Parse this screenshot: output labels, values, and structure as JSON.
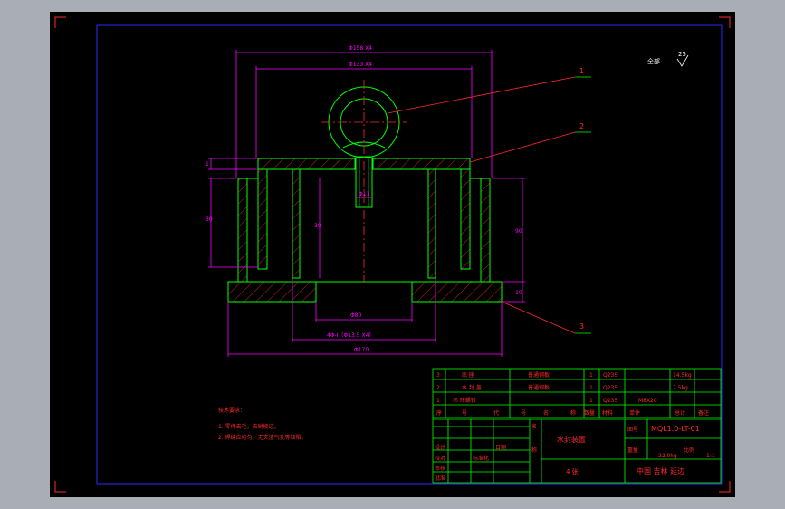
{
  "drawing": {
    "roughness_note": "全部",
    "roughness_value": "25",
    "balloons": [
      "1",
      "2",
      "3"
    ],
    "dimensions": {
      "top_outer": "Φ158 X4",
      "top_inner": "Φ133 X4",
      "hole": "Φ11",
      "bottom_inner": "Φ80",
      "bottom_holes": "4Φ-Ⅰ（Φ13.5 X4）",
      "bottom_outer": "Φ170",
      "left_height": "30",
      "inner_height": "30",
      "right_height": "90",
      "top_small": "1",
      "bottom_small": "10"
    },
    "tech_requirements": {
      "title": "技术要求：",
      "item1": "1. 零件去毛，去锐棱边。",
      "item2": "2. 焊缝应均匀，无夹渣气孔等缺陷。"
    }
  },
  "parts_list": {
    "rows": [
      {
        "no": "3",
        "name": "底 座",
        "material_note": "普通钢板",
        "qty": "1",
        "material": "Q235",
        "weight": "14.5kg"
      },
      {
        "no": "2",
        "name": "水 封 盖",
        "material_note": "普通钢板",
        "qty": "1",
        "material": "Q235",
        "weight": "7.5kg"
      },
      {
        "no": "1",
        "name": "吊 环螺钉",
        "material_note": "",
        "qty": "1",
        "material": "Q235",
        "weight": "M8X20"
      }
    ],
    "header": [
      "序",
      "号",
      "代",
      "号",
      "名",
      "称",
      "数量",
      "材料",
      "单件",
      "总计",
      "备注"
    ]
  },
  "title_block": {
    "drawing_name": "水封装置",
    "drawing_number": "MQL1.0-LT-01",
    "weight": "22.0kg",
    "scale": "1:1",
    "sheet": "4 张",
    "company": "中国 吉林 延边",
    "labels": [
      "名",
      "称",
      "图号",
      "重量",
      "比例",
      "设计",
      "校对",
      "审核",
      "日期",
      "标准化",
      "批准"
    ]
  },
  "colors": {
    "frame": "#2b2bff",
    "outline": "#00ff00",
    "hatch": "#ff2a2a",
    "dimension": "#ff00ff",
    "leader": "#ff2a2a",
    "text": "#ffffff",
    "background": "#000000"
  }
}
